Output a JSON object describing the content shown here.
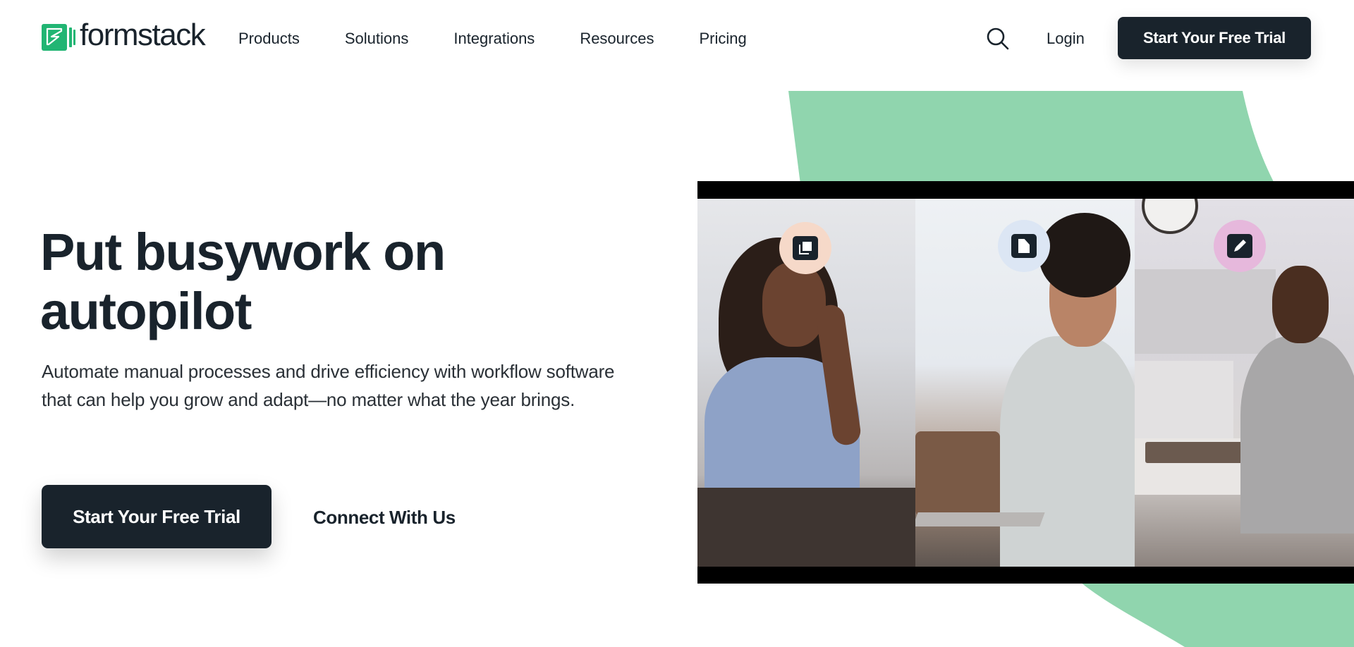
{
  "brand": {
    "name": "formstack",
    "logo_icon": "formstack-logo-icon",
    "color": "#21b573"
  },
  "header": {
    "nav": [
      {
        "label": "Products"
      },
      {
        "label": "Solutions"
      },
      {
        "label": "Integrations"
      },
      {
        "label": "Resources"
      },
      {
        "label": "Pricing"
      }
    ],
    "search_icon": "search-icon",
    "login_label": "Login",
    "cta_label": "Start Your Free Trial"
  },
  "hero": {
    "headline_line1": "Put busywork on",
    "headline_line2": "autopilot",
    "subtext": "Automate manual processes and drive efficiency with workflow software that can help you grow and adapt—no matter what the year brings.",
    "primary_cta": "Start Your Free Trial",
    "secondary_cta": "Connect With Us"
  },
  "media": {
    "type": "video",
    "panels": [
      {
        "badge_icon": "copy-icon",
        "badge_color": "#f6d9c9",
        "scene": "woman smiling at a desk"
      },
      {
        "badge_icon": "document-icon",
        "badge_color": "#dce6f4",
        "scene": "man typing on laptop"
      },
      {
        "badge_icon": "pencil-icon",
        "badge_color": "#e6b8dc",
        "scene": "medical worker typing at desk"
      }
    ]
  },
  "colors": {
    "dark": "#19232c",
    "accent_green_shape": "#90d5ae",
    "background": "#ffffff"
  }
}
